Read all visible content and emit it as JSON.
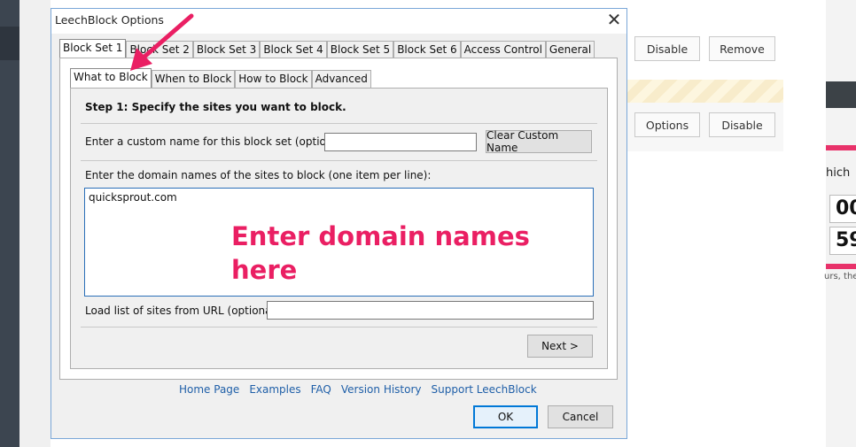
{
  "background": {
    "buttons": {
      "disable_1": "Disable",
      "remove": "Remove",
      "options": "Options",
      "disable_2": "Disable"
    },
    "right_panel": {
      "which_text": "hich",
      "box1": "00",
      "box2": "59",
      "hours_text": "urs, the"
    }
  },
  "dialog": {
    "title": "LeechBlock Options",
    "close_glyph": "✕",
    "outer_tabs": [
      "Block Set 1",
      "Block Set 2",
      "Block Set 3",
      "Block Set 4",
      "Block Set 5",
      "Block Set 6",
      "Access Control",
      "General"
    ],
    "inner_tabs": [
      "What to Block",
      "When to Block",
      "How to Block",
      "Advanced"
    ],
    "step_title": "Step 1: Specify the sites you want to block.",
    "custom_name_label": "Enter a custom name for this block set (optional):",
    "custom_name_value": "",
    "clear_button": "Clear Custom Name",
    "domains_label": "Enter the domain names of the sites to block (one item per line):",
    "domains_value": "quicksprout.com",
    "url_label": "Load list of sites from URL (optional):",
    "url_value": "",
    "next_button": "Next >",
    "footer_links": [
      "Home Page",
      "Examples",
      "FAQ",
      "Version History",
      "Support LeechBlock"
    ],
    "ok_button": "OK",
    "cancel_button": "Cancel"
  },
  "annotation": {
    "text": "Enter domain names here",
    "color": "#ea1f63"
  }
}
